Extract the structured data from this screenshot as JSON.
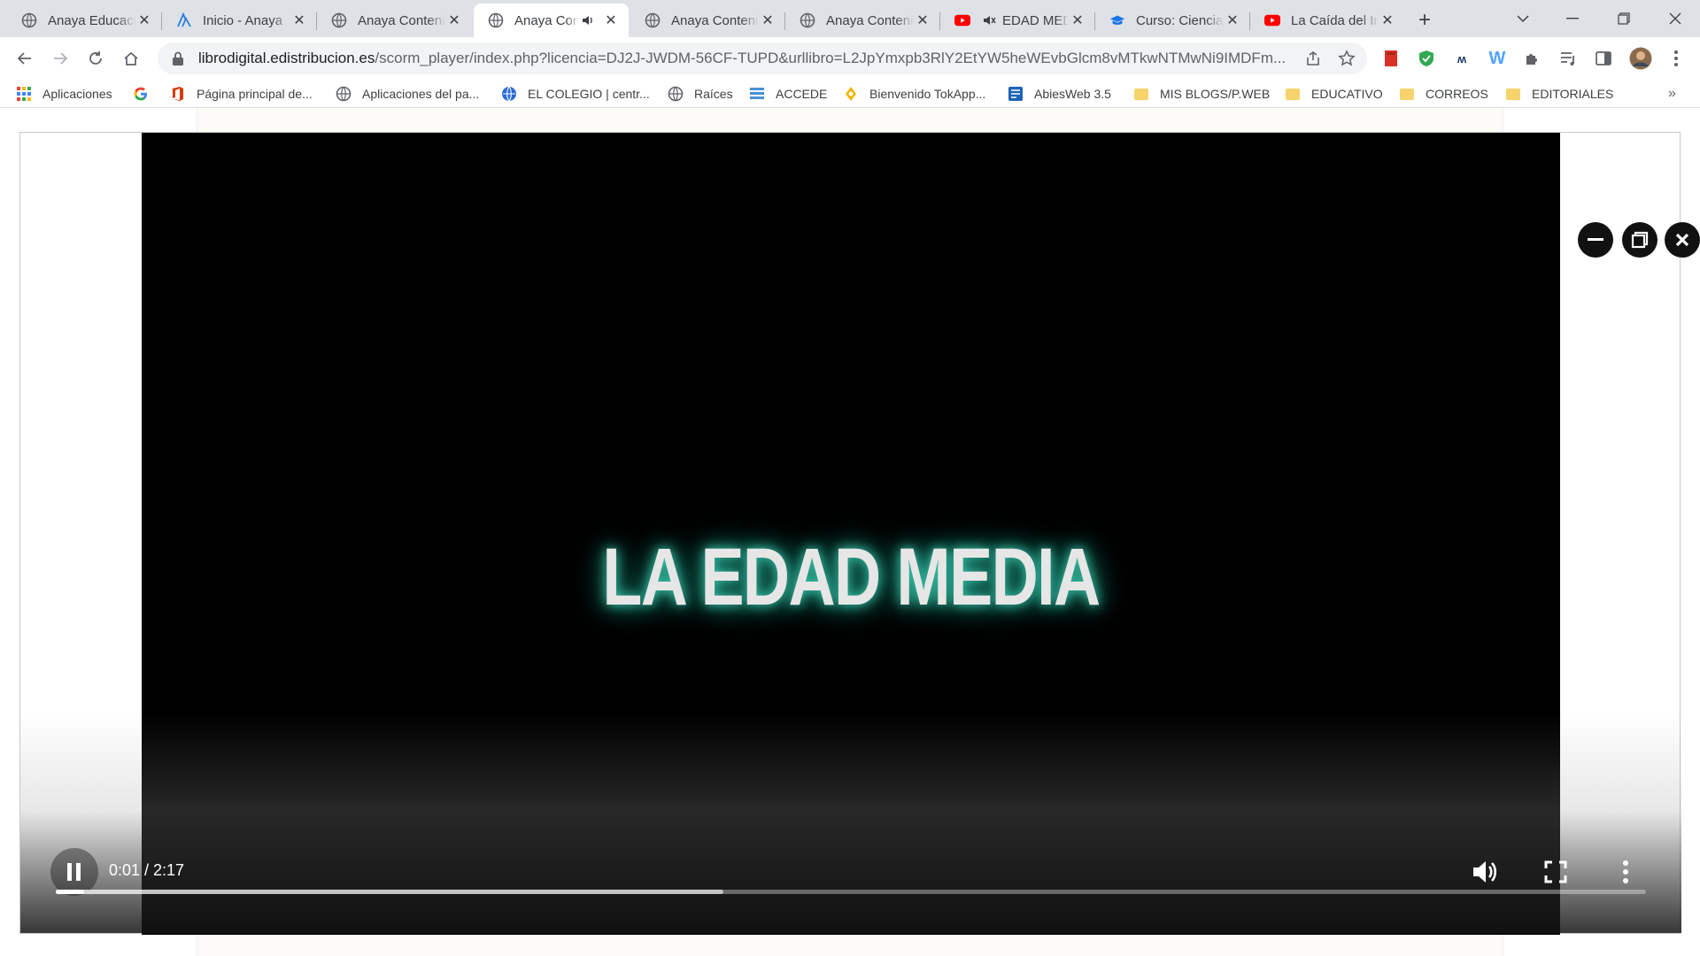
{
  "tabs": [
    {
      "title": "Anaya Educación",
      "favicon": "globe-icon",
      "active": false
    },
    {
      "title": "Inicio - Anaya",
      "favicon": "anaya-logo-icon",
      "active": false
    },
    {
      "title": "Anaya Contenidos",
      "favicon": "globe-icon",
      "active": false
    },
    {
      "title": "Anaya Contenidos",
      "favicon": "globe-icon",
      "active": true,
      "audio": true
    },
    {
      "title": "Anaya Contenidos",
      "favicon": "globe-icon",
      "active": false
    },
    {
      "title": "Anaya Contenidos",
      "favicon": "globe-icon",
      "active": false
    },
    {
      "title": "EDAD MEDIA",
      "favicon": "youtube-icon",
      "active": false
    },
    {
      "title": "Curso: Ciencias",
      "favicon": "graduation-cap-icon",
      "active": false
    },
    {
      "title": "La Caída del Imperio",
      "favicon": "youtube-icon",
      "active": false
    }
  ],
  "address_bar": {
    "host": "librodigital.edistribucion.es",
    "path": "/scorm_player/index.php?licencia=DJ2J-JWDM-56CF-TUPD&urllibro=L2JpYmxpb3RlY2EtYW5heWEvbGlcm8vMTkwNTMwNi9IMDFm..."
  },
  "bookmarks": [
    {
      "label": "Aplicaciones",
      "icon": "apps-grid-icon"
    },
    {
      "label": "",
      "icon": "google-icon"
    },
    {
      "label": "Página principal de...",
      "icon": "office-icon"
    },
    {
      "label": "Aplicaciones del pa...",
      "icon": "globe-icon"
    },
    {
      "label": "EL COLEGIO | centr...",
      "icon": "school-globe-icon"
    },
    {
      "label": "Raíces",
      "icon": "globe-icon"
    },
    {
      "label": "ACCEDE",
      "icon": "accede-icon"
    },
    {
      "label": "Bienvenido TokApp...",
      "icon": "tokapp-icon"
    },
    {
      "label": "AbiesWeb 3.5",
      "icon": "abies-icon"
    },
    {
      "label": "MIS BLOGS/P.WEB",
      "icon": "folder-icon"
    },
    {
      "label": "EDUCATIVO",
      "icon": "folder-icon"
    },
    {
      "label": "CORREOS",
      "icon": "folder-icon"
    },
    {
      "label": "EDITORIALES",
      "icon": "folder-icon"
    }
  ],
  "video": {
    "title_text": "LA EDAD MEDIA",
    "current_time": "0:01",
    "duration": "2:17",
    "time_display": "0:01 / 2:17",
    "played_fraction": 0.018,
    "buffered_fraction": 0.42
  },
  "colors": {
    "tab_strip": "#dee1e6",
    "glow": "#3fd0b2"
  }
}
